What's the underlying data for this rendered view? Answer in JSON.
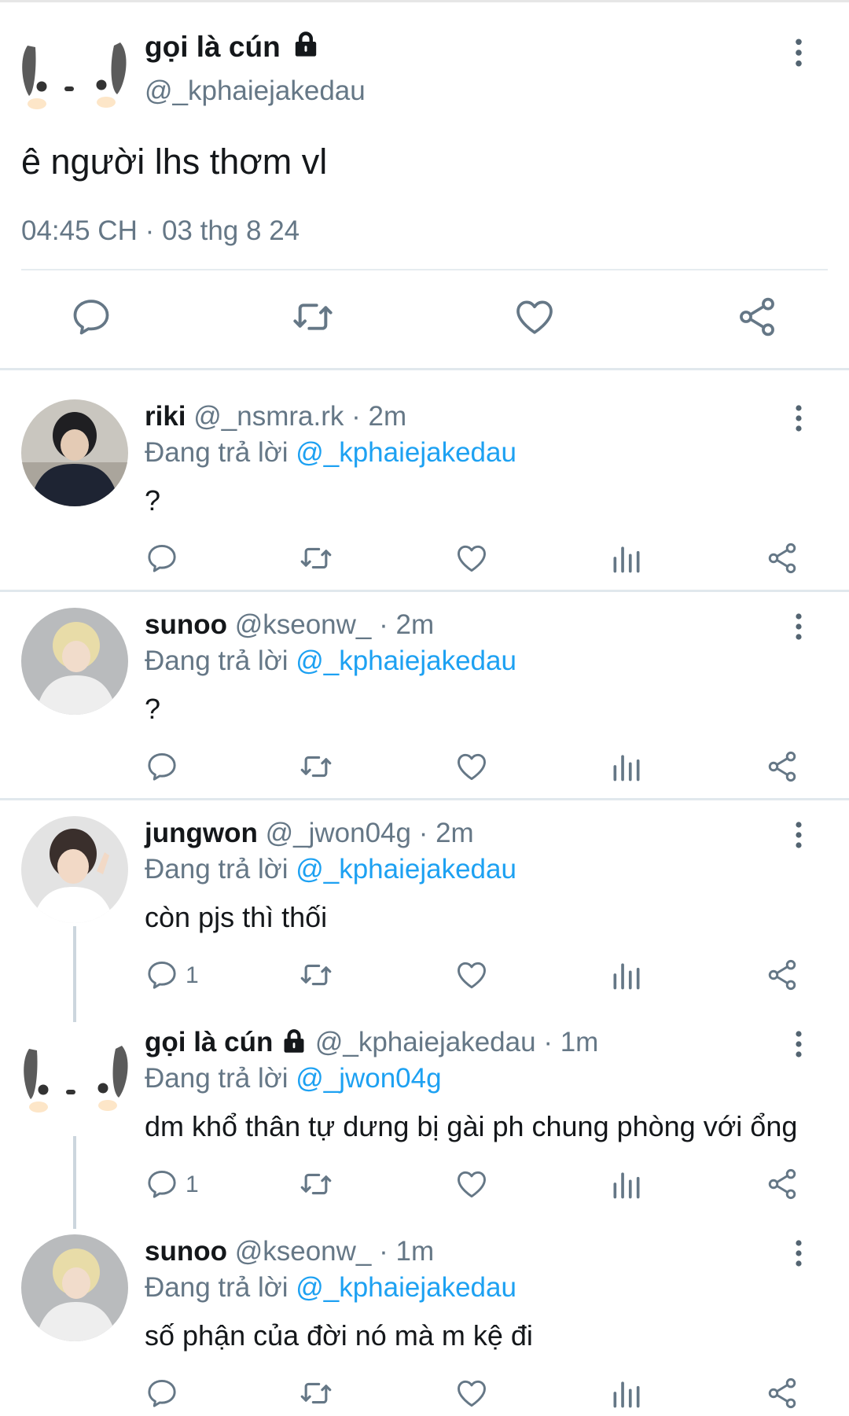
{
  "main_tweet": {
    "display_name": "gọi là cún",
    "handle": "@_kphaiejakedau",
    "text": "ê người lhs thơm vl",
    "timestamp": "04:45 CH · 03 thg 8 24",
    "locked_icon": "lock-icon",
    "actions": [
      "reply-icon",
      "retweet-icon",
      "like-icon",
      "share-icon"
    ]
  },
  "replies": [
    {
      "name": "riki",
      "handle": "@_nsmra.rk",
      "time": "· 2m",
      "replying_prefix": "Đang trả lời",
      "replying_to": "@_kphaiejakedau",
      "text": "?",
      "reply_count": ""
    },
    {
      "name": "sunoo",
      "handle": "@kseonw_",
      "time": "· 2m",
      "replying_prefix": "Đang trả lời",
      "replying_to": "@_kphaiejakedau",
      "text": "?",
      "reply_count": ""
    },
    {
      "name": "jungwon",
      "handle": "@_jwon04g",
      "time": "· 2m",
      "replying_prefix": "Đang trả lời",
      "replying_to": "@_kphaiejakedau",
      "text": "còn pjs thì thối",
      "reply_count": "1"
    },
    {
      "name": "gọi là cún",
      "handle": "@_kphaiejakedau",
      "time": "· 1m",
      "replying_prefix": "Đang trả lời",
      "replying_to": "@_jwon04g",
      "text": "dm khổ thân tự dưng bị gài ph chung phòng với ổng",
      "reply_count": "1"
    },
    {
      "name": "sunoo",
      "handle": "@kseonw_",
      "time": "· 1m",
      "replying_prefix": "Đang trả lời",
      "replying_to": "@_kphaiejakedau",
      "text": "số phận của đời nó mà m kệ đi",
      "reply_count": ""
    }
  ],
  "colors": {
    "accent": "#1da1f2",
    "secondary_text": "#657786",
    "icon": "#657786"
  }
}
